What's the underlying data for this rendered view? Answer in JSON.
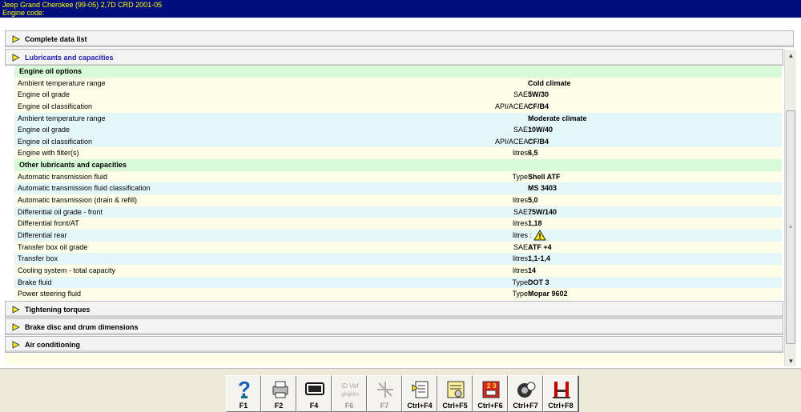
{
  "title": {
    "line1": "Jeep   Grand Cherokee (99-05) 2,7D CRD 2001-05",
    "line2": "Engine code:"
  },
  "sections": {
    "complete": "Complete data list",
    "lubricants": "Lubricants and capacities",
    "torques": "Tightening torques",
    "brakes": "Brake disc and drum dimensions",
    "aircon": "Air conditioning"
  },
  "rows": [
    {
      "type": "subheader",
      "label": "Engine oil options"
    },
    {
      "type": "cream",
      "label": "Ambient temperature range",
      "unit": "",
      "value": "Cold climate"
    },
    {
      "type": "cream",
      "label": "Engine oil grade",
      "unit": "SAE",
      "value": "5W/30"
    },
    {
      "type": "cream",
      "label": "Engine oil classification",
      "unit": "API/ACEA",
      "value": "CF/B4"
    },
    {
      "type": "cyan",
      "label": "Ambient temperature range",
      "unit": "",
      "value": "Moderate climate"
    },
    {
      "type": "cyan",
      "label": "Engine oil grade",
      "unit": "SAE",
      "value": "10W/40"
    },
    {
      "type": "cyan",
      "label": "Engine oil classification",
      "unit": "API/ACEA",
      "value": "CF/B4"
    },
    {
      "type": "cream",
      "label": "Engine with filter(s)",
      "unit": "litres",
      "value": "6,5"
    },
    {
      "type": "subheader",
      "label": "Other lubricants and capacities"
    },
    {
      "type": "cream",
      "label": "Automatic transmission fluid",
      "unit": "Type",
      "value": "Shell ATF"
    },
    {
      "type": "cyan",
      "label": "Automatic transmission fluid classification",
      "unit": "",
      "value": "MS 3403"
    },
    {
      "type": "cream",
      "label": "Automatic transmission (drain & refill)",
      "unit": "litres",
      "value": "5,0"
    },
    {
      "type": "cyan",
      "label": "Differential oil grade - front",
      "unit": "SAE",
      "value": "75W/140"
    },
    {
      "type": "cream",
      "label": "Differential front/AT",
      "unit": "litres",
      "value": "1,18"
    },
    {
      "type": "cyan",
      "label": "Differential rear",
      "unit": "litres",
      "value": "",
      "warning": true
    },
    {
      "type": "cream",
      "label": "Transfer box oil grade",
      "unit": "SAE",
      "value": "ATF +4"
    },
    {
      "type": "cyan",
      "label": "Transfer box",
      "unit": "litres",
      "value": "1,1-1,4"
    },
    {
      "type": "cream",
      "label": "Cooling system - total capacity",
      "unit": "litres",
      "value": "14"
    },
    {
      "type": "cyan",
      "label": "Brake fluid",
      "unit": "Type",
      "value": "DOT 3"
    },
    {
      "type": "cream",
      "label": "Power steering fluid",
      "unit": "Type",
      "value": "Mopar 9602"
    }
  ],
  "toolbar": [
    {
      "label": "F1",
      "icon": "help-icon",
      "enabled": true
    },
    {
      "label": "F2",
      "icon": "printer-icon",
      "enabled": true
    },
    {
      "label": "F4",
      "icon": "display-icon",
      "enabled": true
    },
    {
      "label": "F6",
      "icon": "ident-icon",
      "enabled": false
    },
    {
      "label": "F7",
      "icon": "crosshair-icon",
      "enabled": false
    },
    {
      "label": "Ctrl+F4",
      "icon": "document-icon",
      "enabled": true
    },
    {
      "label": "Ctrl+F5",
      "icon": "list-icon",
      "enabled": true
    },
    {
      "label": "Ctrl+F6",
      "icon": "red-unit-icon",
      "enabled": true
    },
    {
      "label": "Ctrl+F7",
      "icon": "tyre-icon",
      "enabled": true
    },
    {
      "label": "Ctrl+F8",
      "icon": "lift-icon",
      "enabled": true
    }
  ],
  "colors": {
    "title_bg": "#000e7d",
    "title_fg": "#ffff00",
    "subheader_bg": "#d7fad7",
    "row_cream": "#fefde8",
    "row_cyan": "#e3f7f9",
    "expanded_header_fg": "#1f1fc9"
  }
}
